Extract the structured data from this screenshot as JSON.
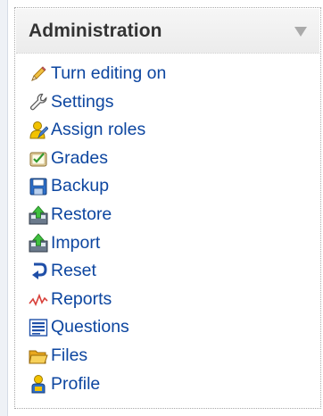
{
  "block": {
    "title": "Administration",
    "items": [
      {
        "label": "Turn editing on",
        "icon": "pencil-icon"
      },
      {
        "label": "Settings",
        "icon": "wrench-icon"
      },
      {
        "label": "Assign roles",
        "icon": "user-roles-icon"
      },
      {
        "label": "Grades",
        "icon": "grades-icon"
      },
      {
        "label": "Backup",
        "icon": "floppy-disk-icon"
      },
      {
        "label": "Restore",
        "icon": "restore-icon"
      },
      {
        "label": "Import",
        "icon": "import-icon"
      },
      {
        "label": "Reset",
        "icon": "reset-icon"
      },
      {
        "label": "Reports",
        "icon": "reports-icon"
      },
      {
        "label": "Questions",
        "icon": "questions-icon"
      },
      {
        "label": "Files",
        "icon": "folder-icon"
      },
      {
        "label": "Profile",
        "icon": "profile-icon"
      }
    ]
  },
  "colors": {
    "link": "#0d46a0",
    "title": "#333333",
    "header_bg": "#efefef",
    "border": "#a9a9a9"
  }
}
